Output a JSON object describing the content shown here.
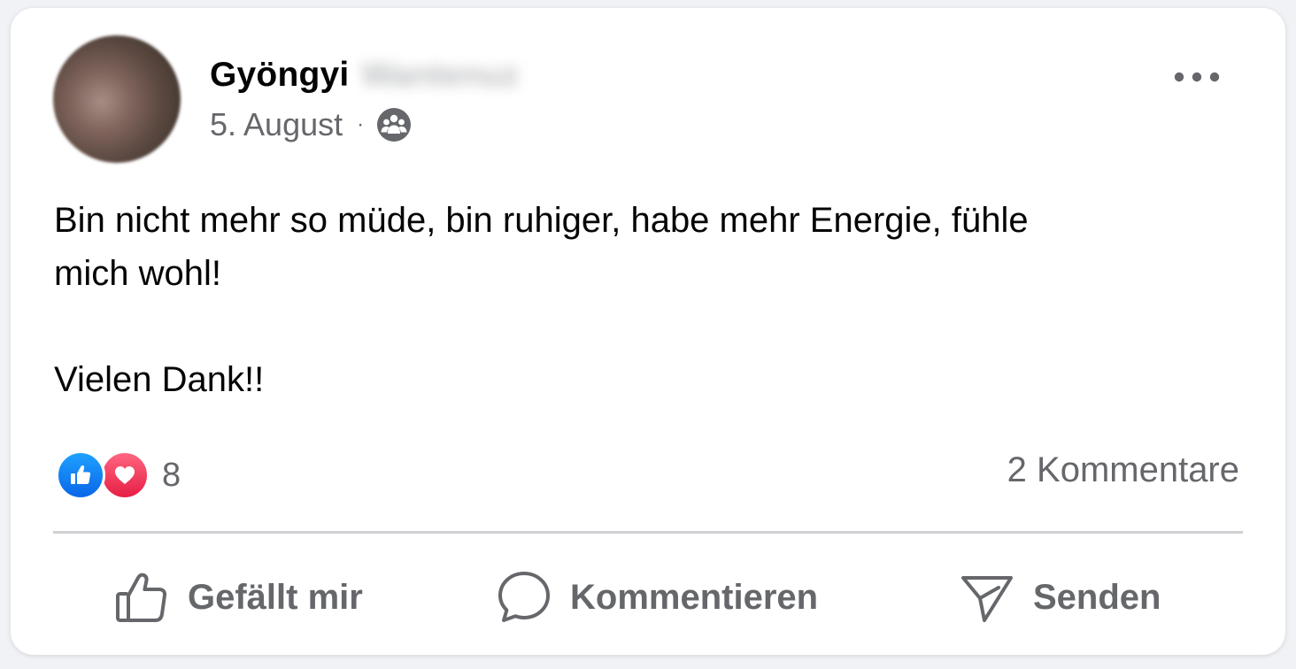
{
  "post": {
    "author_first_name": "Gyöngyi",
    "author_last_name_blurred": "Wantenuz",
    "date": "5. August",
    "meta_separator": "·",
    "audience_icon": "friends-icon",
    "text_line1": "Bin nicht mehr so müde, bin ruhiger, habe mehr Energie, fühle",
    "text_line2": "mich wohl!",
    "text_line3": "Vielen Dank!!"
  },
  "stats": {
    "reaction_icons": [
      "like-icon",
      "love-icon"
    ],
    "reaction_count": "8",
    "comments": "2 Kommentare"
  },
  "actions": {
    "like_label": "Gefällt mir",
    "comment_label": "Kommentieren",
    "send_label": "Senden"
  },
  "colors": {
    "like_blue": "#0a66e8",
    "love_red": "#e61e45",
    "text_secondary": "#65676b",
    "text_primary": "#050505"
  }
}
